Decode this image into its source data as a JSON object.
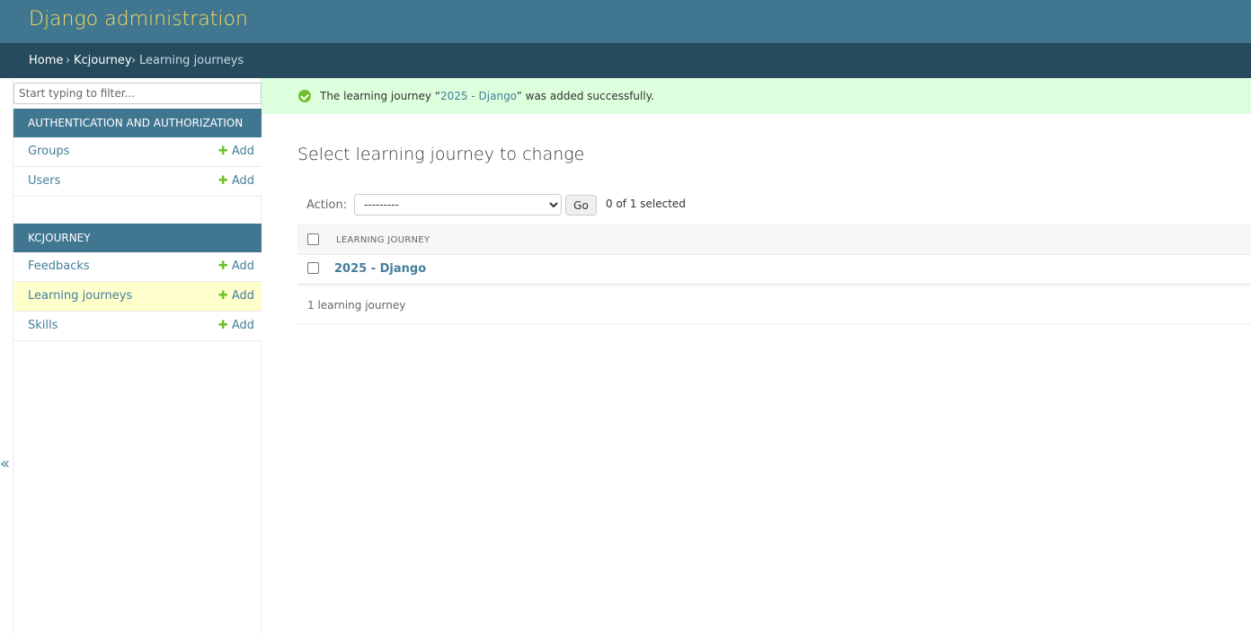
{
  "header": {
    "site_title": "Django administration"
  },
  "breadcrumbs": {
    "home": "Home",
    "sep1": "›",
    "app": "Kcjourney",
    "sep2": "›",
    "current": "Learning journeys"
  },
  "sidebar": {
    "filter_placeholder": "Start typing to filter...",
    "modules": [
      {
        "caption": "AUTHENTICATION AND AUTHORIZATION",
        "models": [
          {
            "label": "Groups",
            "add": "Add",
            "selected": false
          },
          {
            "label": "Users",
            "add": "Add",
            "selected": false
          }
        ]
      },
      {
        "caption": "KCJOURNEY",
        "models": [
          {
            "label": "Feedbacks",
            "add": "Add",
            "selected": false
          },
          {
            "label": "Learning journeys",
            "add": "Add",
            "selected": true
          },
          {
            "label": "Skills",
            "add": "Add",
            "selected": false
          }
        ]
      }
    ],
    "add_icon": "plus-icon",
    "toggle_glyph": "«"
  },
  "message": {
    "prefix": "The learning journey “",
    "link": "2025 - Django",
    "suffix": "” was added successfully.",
    "icon": "check-circle-icon"
  },
  "content": {
    "title": "Select learning journey to change",
    "action_label": "Action:",
    "action_selected": "---------",
    "go_label": "Go",
    "selected_count": "0 of 1 selected",
    "column_header": "LEARNING JOURNEY",
    "rows": [
      {
        "label": "2025 - Django"
      }
    ],
    "paginator": "1 learning journey"
  },
  "colors": {
    "header_bg": "#417690",
    "breadcrumbs_bg": "#264b5d",
    "title": "#f5dd5d",
    "link": "#447e9b",
    "success_bg": "#ddffdd",
    "add_plus": "#70bf2b",
    "selected_row": "#ffffcc"
  }
}
